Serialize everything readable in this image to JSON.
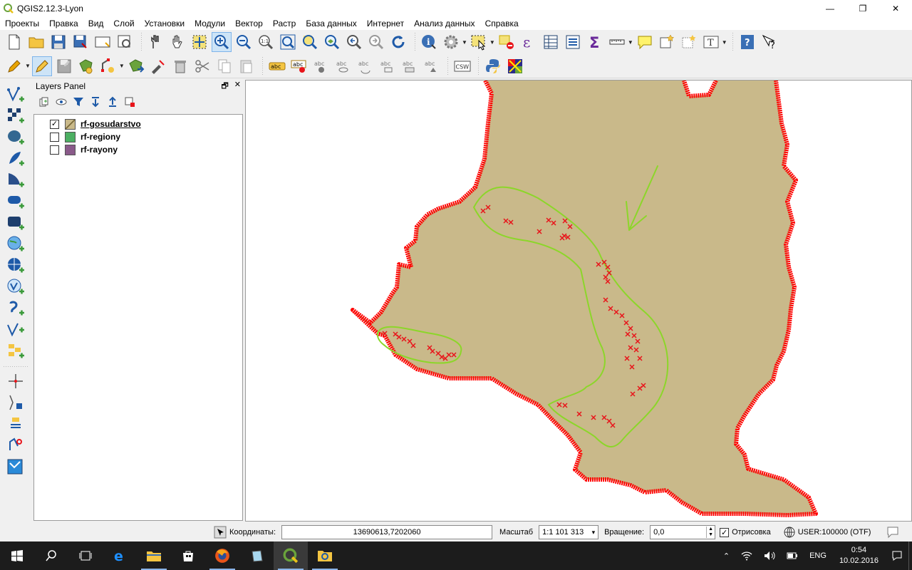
{
  "window": {
    "title": "QGIS2.12.3-Lyon",
    "minimize": "—",
    "restore": "❐",
    "close": "✕"
  },
  "menu": [
    "Проекты",
    "Правка",
    "Вид",
    "Слой",
    "Установки",
    "Модули",
    "Вектор",
    "Растр",
    "База данных",
    "Интернет",
    "Анализ данных",
    "Справка"
  ],
  "toolbar2": {
    "csw_label": "CSW",
    "abc": "abc"
  },
  "layers_panel": {
    "title": "Layers Panel",
    "float": "🗗",
    "close": "✕",
    "layers": [
      {
        "name": "rf-gosudarstvo",
        "checked": "✓",
        "color": "#c9b98a"
      },
      {
        "name": "rf-regiony",
        "checked": "",
        "color": "#4caf62"
      },
      {
        "name": "rf-rayony",
        "checked": "",
        "color": "#8a5a8a"
      }
    ]
  },
  "status": {
    "coord_label": "Координаты:",
    "coord_value": "13690613,7202060",
    "scale_label": "Масштаб",
    "scale_value": "1:1 101 313",
    "rotation_label": "Вращение:",
    "rotation_value": "0,0",
    "render_label": "Отрисовка",
    "render_checked": "✓",
    "crs_label": "USER:100000 (OTF)"
  },
  "taskbar": {
    "lang": "ENG",
    "time": "0:54",
    "date": "10.02.2016"
  },
  "colors": {
    "land": "#c9b98a",
    "border": "#ff0000",
    "selection": "#8cd62a",
    "points": "#e8141a"
  }
}
